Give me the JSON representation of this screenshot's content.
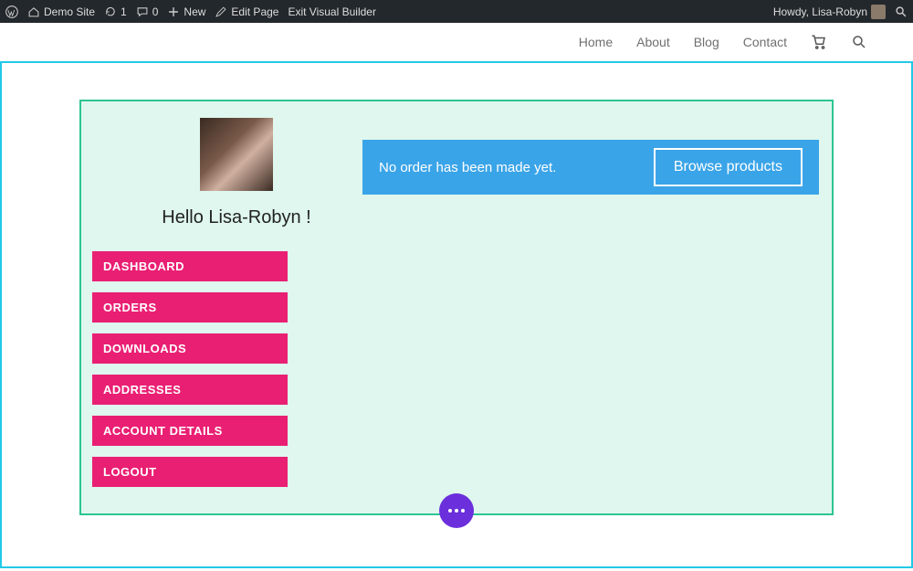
{
  "adminbar": {
    "site_name": "Demo Site",
    "refresh_count": "1",
    "comments_count": "0",
    "new_label": "New",
    "edit_page": "Edit Page",
    "exit_builder": "Exit Visual Builder",
    "howdy": "Howdy, Lisa-Robyn"
  },
  "nav": {
    "items": [
      "Home",
      "About",
      "Blog",
      "Contact"
    ]
  },
  "account": {
    "greeting": "Hello Lisa-Robyn !",
    "menu": [
      "DASHBOARD",
      "ORDERS",
      "DOWNLOADS",
      "ADDRESSES",
      "ACCOUNT DETAILS",
      "LOGOUT"
    ]
  },
  "notice": {
    "message": "No order has been made yet.",
    "cta": "Browse products"
  }
}
